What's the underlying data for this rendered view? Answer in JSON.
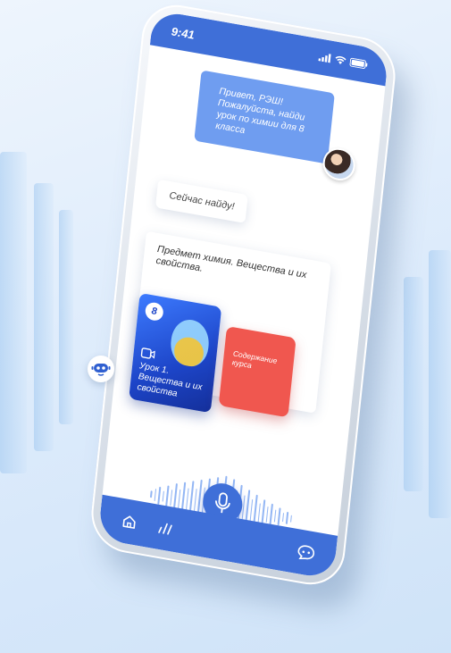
{
  "status_bar": {
    "time": "9:41"
  },
  "chat": {
    "user_message": "Привет, РЭШ! Пожалуйста, найди урок по химии для 8 класса",
    "bot_reply_1": "Сейчас найду!",
    "bot_reply_2": "Предмет химия. Вещества и их свойства.",
    "lesson_card": {
      "grade": "8",
      "title": "Урок 1. Вещества и их свойства"
    },
    "contents_card": {
      "title": "Содержание курса"
    }
  },
  "icons": {
    "status": [
      "signal-icon",
      "wifi-icon",
      "battery-icon"
    ],
    "bottom_left": [
      "home-icon",
      "stats-icon"
    ],
    "bottom_right": "chat-icon",
    "mic": "microphone-icon",
    "bot": "robot-icon",
    "lesson": "video-icon"
  },
  "colors": {
    "accent": "#3f6fd8",
    "user_bubble": "#6f9df0",
    "contents_card": "#f0574f",
    "lesson_card": "#1d45c8"
  }
}
